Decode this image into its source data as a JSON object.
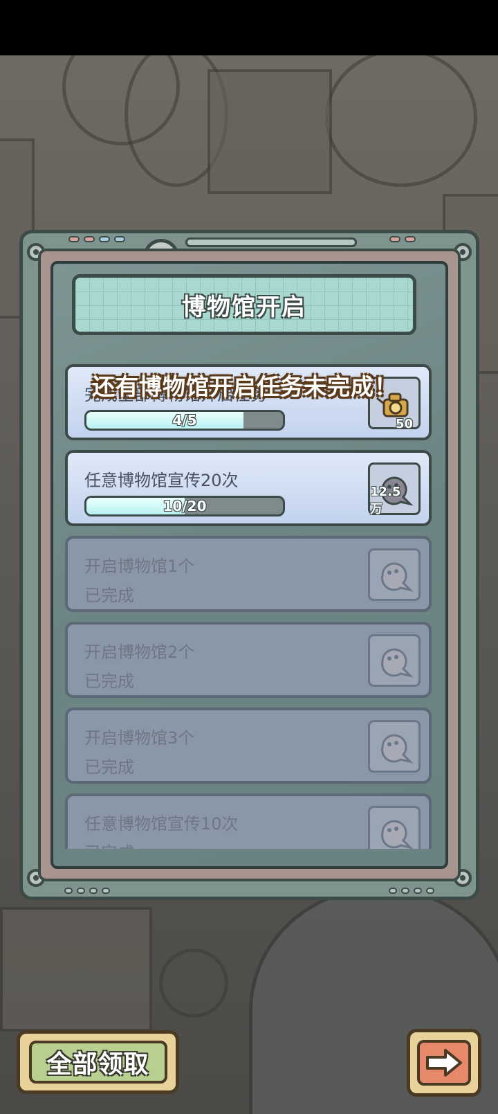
{
  "panel": {
    "title": "博物馆开启"
  },
  "toast": "还有博物馆开启任务未完成！",
  "tasks": [
    {
      "name": "完成全部博物馆开启任务",
      "progress": "4/5",
      "progress_fraction": 0.8,
      "reward_amount": "50",
      "reward_icon": "golden-camera-icon",
      "done": false
    },
    {
      "name": "任意博物馆宣传20次",
      "progress": "10/20",
      "progress_fraction": 0.5,
      "reward_amount": "12.5万",
      "reward_icon": "ghost-token-icon",
      "done": false
    },
    {
      "name": "开启博物馆1个",
      "status": "已完成",
      "reward_icon": "ghost-token-icon",
      "done": true
    },
    {
      "name": "开启博物馆2个",
      "status": "已完成",
      "reward_icon": "ghost-token-icon",
      "done": true
    },
    {
      "name": "开启博物馆3个",
      "status": "已完成",
      "reward_icon": "ghost-token-icon",
      "done": true
    },
    {
      "name": "任意博物馆宣传10次",
      "status": "已完成",
      "reward_icon": "ghost-token-icon",
      "done": true
    }
  ],
  "buttons": {
    "claim_all": "全部领取",
    "next_icon": "right-arrow-icon"
  },
  "colors": {
    "panel_teal": "#7f938f",
    "title_plate": "#a9d8d1",
    "progress_fill": "#b9f2f2",
    "claim_green": "#b8d08f",
    "next_orange": "#e6896a"
  }
}
